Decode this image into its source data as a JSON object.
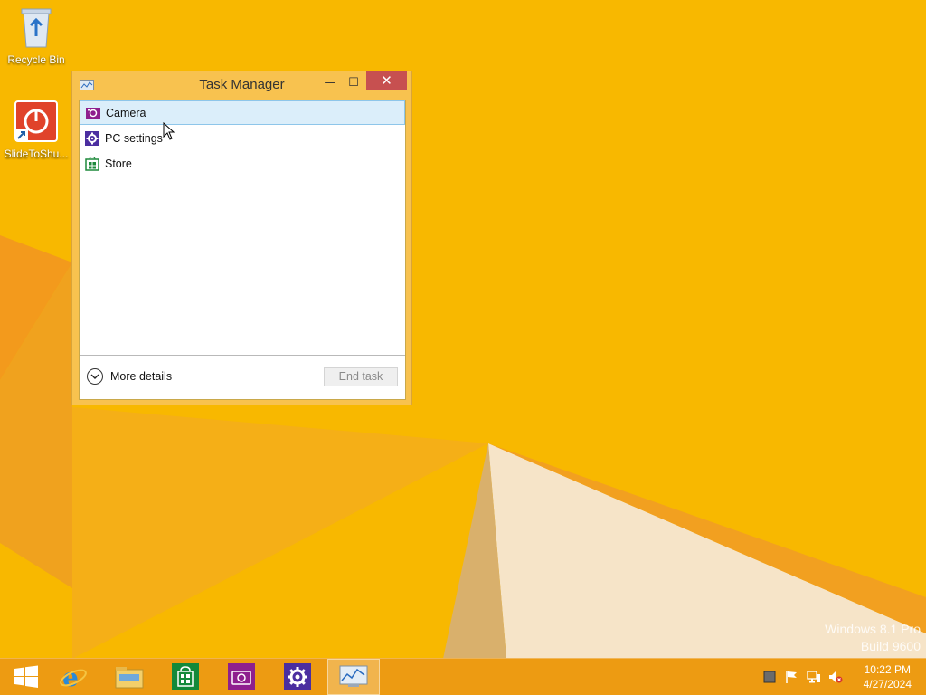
{
  "desktop": {
    "icons": [
      {
        "label": "Recycle Bin",
        "icon": "recycle-bin-icon"
      },
      {
        "label": "SlideToShu...",
        "icon": "shutdown-shortcut-icon"
      }
    ],
    "watermark": {
      "line1": "Windows 8.1 Pro",
      "line2": "Build 9600"
    }
  },
  "window": {
    "title": "Task Manager",
    "min_glyph": "—",
    "max_glyph": "☐",
    "close_glyph": "✕",
    "apps": [
      {
        "label": "Camera",
        "icon": "camera-icon",
        "color": "#8e1f8e",
        "selected": true
      },
      {
        "label": "PC settings",
        "icon": "settings-gear-icon",
        "color": "#4b2ea0",
        "selected": false
      },
      {
        "label": "Store",
        "icon": "store-icon",
        "color": "#1e8a3c",
        "selected": false
      }
    ],
    "more_details": "More details",
    "end_task": "End task"
  },
  "taskbar": {
    "items": [
      {
        "name": "start-button",
        "icon": "windows-logo-icon"
      },
      {
        "name": "internet-explorer",
        "icon": "internet-explorer-icon"
      },
      {
        "name": "file-explorer",
        "icon": "folder-icon"
      },
      {
        "name": "store",
        "icon": "store-icon"
      },
      {
        "name": "camera",
        "icon": "camera-icon"
      },
      {
        "name": "pc-settings",
        "icon": "settings-gear-icon"
      },
      {
        "name": "task-manager",
        "icon": "task-manager-icon",
        "active": true
      }
    ],
    "clock": {
      "time": "10:22 PM",
      "date": "4/27/2024"
    }
  },
  "colors": {
    "desktop_bg": "#f7b400",
    "window_frame": "#f8c24f",
    "close": "#c75050",
    "selection": "#dbeefa"
  }
}
